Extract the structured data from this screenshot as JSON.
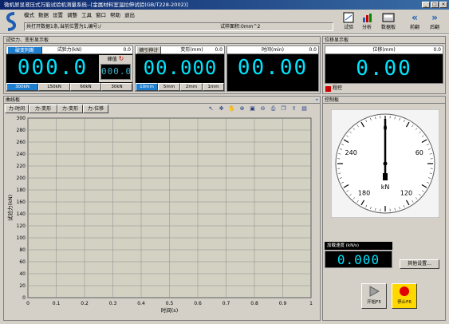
{
  "window": {
    "title": "微机屏显液压式万能试验机测量系统--[金属材料室温拉伸试验(GB/T228-2002)]"
  },
  "menu": [
    "模式",
    "数据",
    "设置",
    "调整",
    "工具",
    "窗口",
    "帮助",
    "退出"
  ],
  "info": {
    "left": "共打开数据1条,当前位置为1,编号:/",
    "right": "试样面积:0mm^2"
  },
  "toolbar": [
    {
      "label": "试验"
    },
    {
      "label": "分析"
    },
    {
      "label": "数据板"
    },
    {
      "label": "前翻"
    },
    {
      "label": "后翻"
    }
  ],
  "force_panel": {
    "header": "试验力、变形显示板",
    "sensor_btn": "破变判断",
    "force": {
      "label": "试验力(kN)",
      "small": "0.0",
      "value": "000.0"
    },
    "peak": {
      "label": "峰值",
      "value": "000.0"
    },
    "ranges": [
      "300kN",
      "150kN",
      "60kN",
      "30kN"
    ],
    "extensometer": {
      "label": "摘引伸计"
    },
    "deform": {
      "label": "变形(mm)",
      "small": "0.0",
      "value": "00.000"
    },
    "deform_ranges": [
      "10mm",
      "5mm",
      "2mm",
      "1mm"
    ],
    "time": {
      "label": "时间(min)",
      "small": "0.0",
      "value": "00.00"
    }
  },
  "disp_panel": {
    "header": "位移显示板",
    "label": "位移(mm)",
    "small": "0.0",
    "value": "0.00",
    "control_label": "程控",
    "control_color": "#cc0000"
  },
  "curve_panel": {
    "header": "曲线板",
    "tabs": [
      "力-时间",
      "力-变形",
      "力-变形",
      "力-位移"
    ],
    "chart_icons": [
      "pointer-icon",
      "move-icon",
      "hand-icon",
      "zoom-in-icon",
      "zoom-area-icon",
      "zoom-out-icon",
      "print-icon",
      "copy-icon",
      "export-icon",
      "settings-icon"
    ]
  },
  "control_panel": {
    "header": "控制板",
    "gauge": {
      "ticks": [
        "0",
        "60",
        "120",
        "180",
        "240"
      ],
      "unit": "kN",
      "needle_value": 0,
      "max": 300
    },
    "speed_label": "加载速度  (kN/s)",
    "speed_value": "0.000",
    "settings_btn": "其他设置...",
    "start_btn": "开始F5",
    "stop_btn": "停止F6"
  },
  "chart_data": {
    "type": "line",
    "xlabel": "时间(s)",
    "ylabel": "试验力(kN)",
    "xlim": [
      0,
      1
    ],
    "ylim": [
      0,
      300
    ],
    "x_ticks": [
      "0",
      "0.1",
      "0.2",
      "0.3",
      "0.4",
      "0.5",
      "0.6",
      "0.7",
      "0.8",
      "0.9",
      "1"
    ],
    "y_ticks": [
      "0",
      "20",
      "40",
      "60",
      "80",
      "100",
      "120",
      "140",
      "160",
      "180",
      "200",
      "220",
      "240",
      "260",
      "280",
      "300"
    ],
    "grid": true,
    "series": []
  }
}
